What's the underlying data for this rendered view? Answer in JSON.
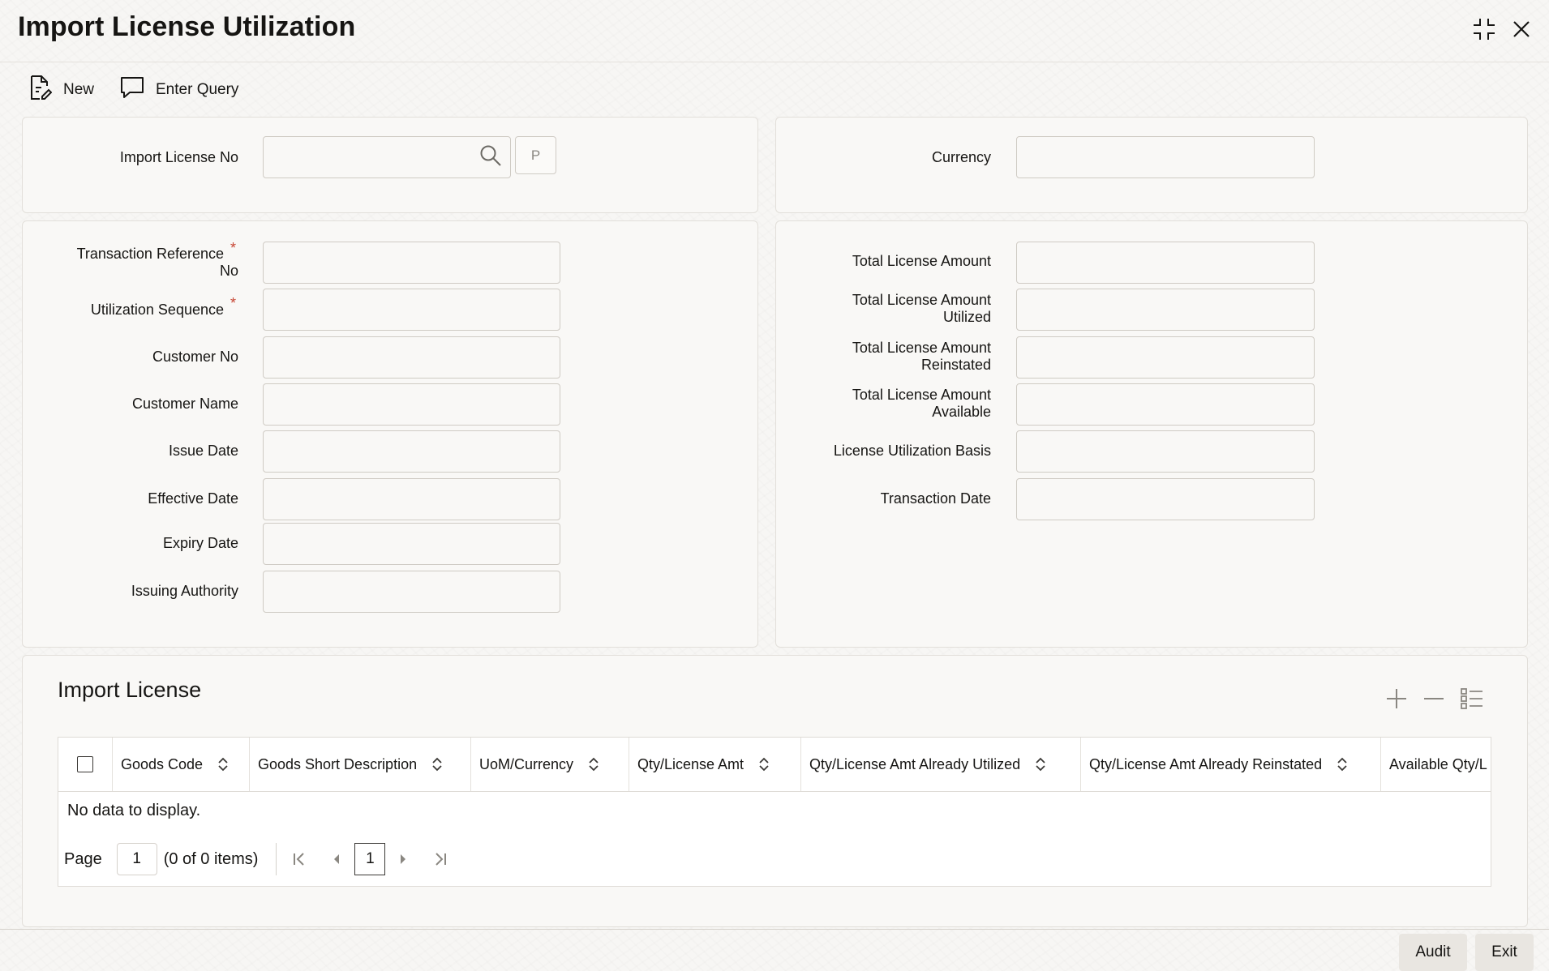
{
  "window": {
    "title": "Import License Utilization"
  },
  "toolbar": {
    "new_label": "New",
    "enter_query_label": "Enter Query"
  },
  "license_panel": {
    "import_license_no_label": "Import License No",
    "import_license_no_value": "",
    "p_button_label": "P",
    "currency_label": "Currency",
    "currency_value": ""
  },
  "details": {
    "transaction_reference_label_line1": "Transaction Reference",
    "transaction_reference_label_line2": "No",
    "utilization_sequence_label": "Utilization Sequence",
    "customer_no_label": "Customer No",
    "customer_name_label": "Customer Name",
    "issue_date_label": "Issue Date",
    "effective_date_label": "Effective Date",
    "expiry_date_label": "Expiry Date",
    "issuing_authority_label": "Issuing Authority",
    "required_marker": "*"
  },
  "amounts": {
    "total_license_amount_label": "Total License Amount",
    "utilized_label_line1": "Total License Amount",
    "utilized_label_line2": "Utilized",
    "reinstated_label_line1": "Total License Amount",
    "reinstated_label_line2": "Reinstated",
    "available_label_line1": "Total License Amount",
    "available_label_line2": "Available",
    "license_utilization_basis_label": "License Utilization Basis",
    "transaction_date_label": "Transaction Date"
  },
  "import_license_grid": {
    "title": "Import License",
    "columns": [
      "Goods Code",
      "Goods Short Description",
      "UoM/Currency",
      "Qty/License Amt",
      "Qty/License Amt Already Utilized",
      "Qty/License Amt Already Reinstated",
      "Available Qty/L"
    ],
    "empty_message": "No data to display.",
    "pager": {
      "page_label": "Page",
      "page_input": "1",
      "items_summary": "(0 of 0 items)",
      "current_page": "1"
    }
  },
  "footer": {
    "audit_label": "Audit",
    "exit_label": "Exit"
  },
  "colors": {
    "required": "#c74634",
    "text": "#161513",
    "button_bg": "#e9e6e1"
  },
  "icons": [
    "new-document-icon",
    "enter-query-icon",
    "search-icon",
    "collapse-icon",
    "close-icon",
    "add-row-icon",
    "delete-row-icon",
    "single-record-view-icon",
    "sort-icon",
    "first-page-icon",
    "previous-page-icon",
    "next-page-icon",
    "last-page-icon"
  ]
}
